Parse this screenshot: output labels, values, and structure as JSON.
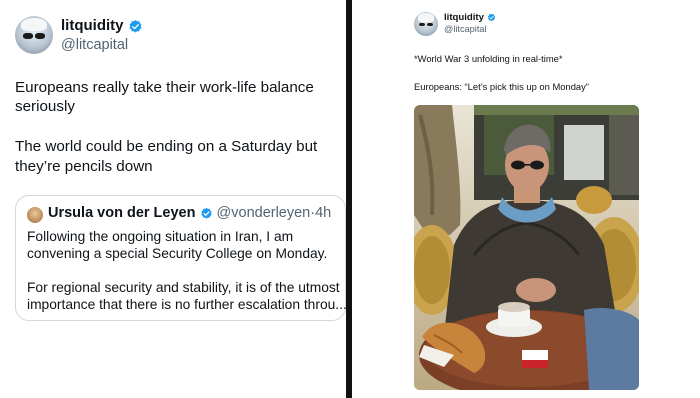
{
  "left_tweet": {
    "author_name": "litquidity",
    "author_handle": "@litcapital",
    "text_lines": [
      "Europeans really take their work-life balance",
      "seriously",
      "The world could be ending on a Saturday but",
      "they’re pencils down"
    ],
    "quote": {
      "author_name": "Ursula von der Leyen",
      "author_handle": "@vonderleyen",
      "separator": "·",
      "time": "4h",
      "lines": [
        "Following the ongoing situation in Iran, I am",
        "convening a special Security College on Monday.",
        "For regional security and stability, it is of the utmost",
        "importance that there is no further escalation throu..."
      ]
    }
  },
  "right_tweet": {
    "author_name": "litquidity",
    "author_handle": "@litcapital",
    "line1": "*World War 3 unfolding in real-time*",
    "line2": "Europeans: “Let’s pick this up on Monday”"
  },
  "colors": {
    "verified": "#1d9bf0",
    "handle": "#536471",
    "border": "#cfd9de",
    "divider": "#111111"
  }
}
